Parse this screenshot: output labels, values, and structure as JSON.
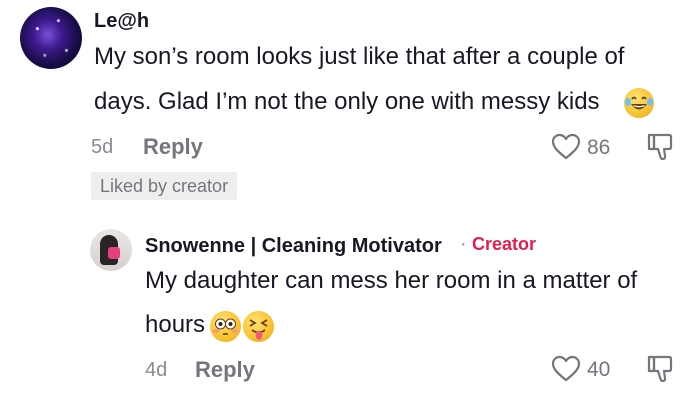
{
  "comment": {
    "username": "Le@h",
    "text_line1": "My son’s room looks just like that after a couple of",
    "text_line2": "days. Glad I’m not the only one with messy kids",
    "emoji": "laughing-tears-emoji",
    "age": "5d",
    "reply_label": "Reply",
    "like_count": "86",
    "liked_badge": "Liked by creator"
  },
  "reply": {
    "username": "Snowenne | Cleaning Motivator",
    "separator": "·",
    "creator_label": "Creator",
    "creator_color": "#e11e4b",
    "text_line1": "My daughter can mess her room in a matter of",
    "text_line2": "hours",
    "emojis": [
      "flushed-face-emoji",
      "squinting-tongue-emoji"
    ],
    "age": "4d",
    "reply_label": "Reply",
    "like_count": "40"
  }
}
